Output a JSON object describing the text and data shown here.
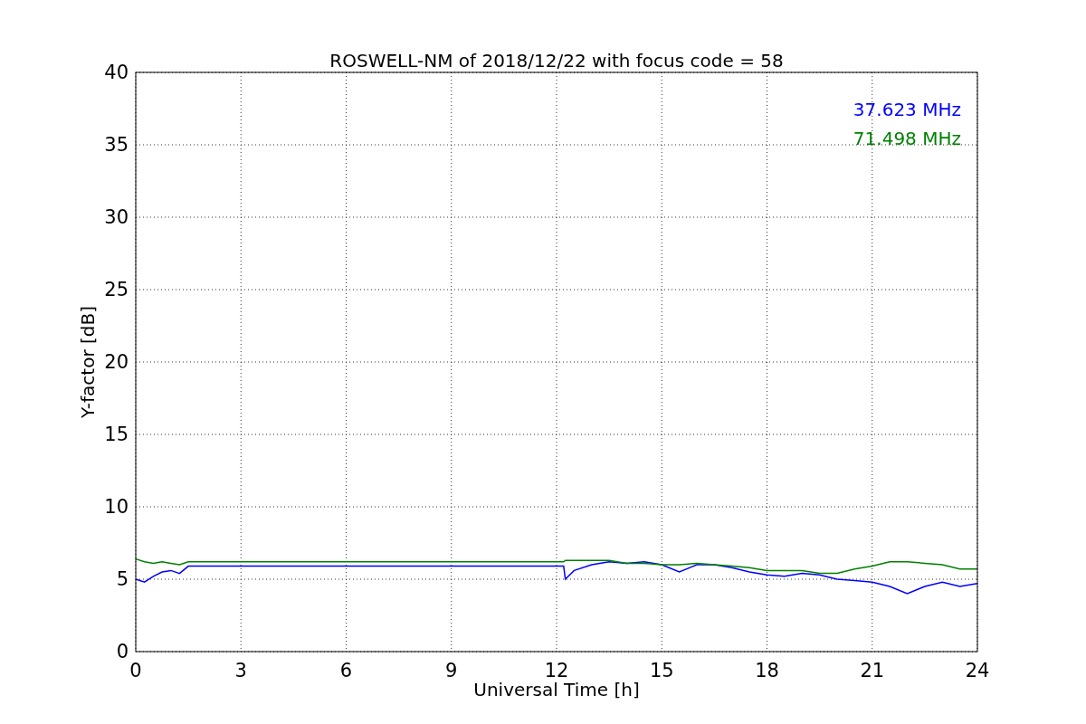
{
  "chart_data": {
    "type": "line",
    "title": "ROSWELL-NM of 2018/12/22 with focus code = 58",
    "xlabel": "Universal Time [h]",
    "ylabel": "Y-factor [dB]",
    "x": [
      0,
      0.25,
      0.5,
      0.75,
      1,
      1.25,
      1.5,
      12.2,
      12.25,
      12.5,
      13,
      13.5,
      14,
      14.5,
      15,
      15.5,
      16,
      16.5,
      17,
      17.5,
      18,
      18.5,
      19,
      19.5,
      20,
      20.5,
      21,
      21.5,
      22,
      22.5,
      23,
      23.5,
      24
    ],
    "series": [
      {
        "name": "37.623 MHz",
        "color": "#0000ff",
        "values": [
          5.0,
          4.8,
          5.2,
          5.5,
          5.6,
          5.4,
          5.9,
          5.9,
          5.0,
          5.6,
          6.0,
          6.2,
          6.1,
          6.2,
          6.0,
          5.5,
          6.0,
          6.0,
          5.8,
          5.5,
          5.3,
          5.2,
          5.4,
          5.3,
          5.0,
          4.9,
          4.8,
          4.5,
          4.0,
          4.5,
          4.8,
          4.5,
          4.7
        ]
      },
      {
        "name": "71.498 MHz",
        "color": "#008000",
        "values": [
          6.4,
          6.2,
          6.1,
          6.2,
          6.1,
          6.0,
          6.2,
          6.2,
          6.3,
          6.3,
          6.3,
          6.3,
          6.1,
          6.1,
          6.0,
          6.0,
          6.1,
          6.0,
          5.9,
          5.8,
          5.6,
          5.6,
          5.6,
          5.4,
          5.4,
          5.7,
          5.9,
          6.2,
          6.2,
          6.1,
          6.0,
          5.7,
          5.7
        ]
      }
    ],
    "xlim": [
      0,
      24
    ],
    "ylim": [
      0,
      40
    ],
    "xticks": [
      0,
      3,
      6,
      9,
      12,
      15,
      18,
      21,
      24
    ],
    "yticks": [
      0,
      5,
      10,
      15,
      20,
      25,
      30,
      35,
      40
    ],
    "grid": true
  }
}
